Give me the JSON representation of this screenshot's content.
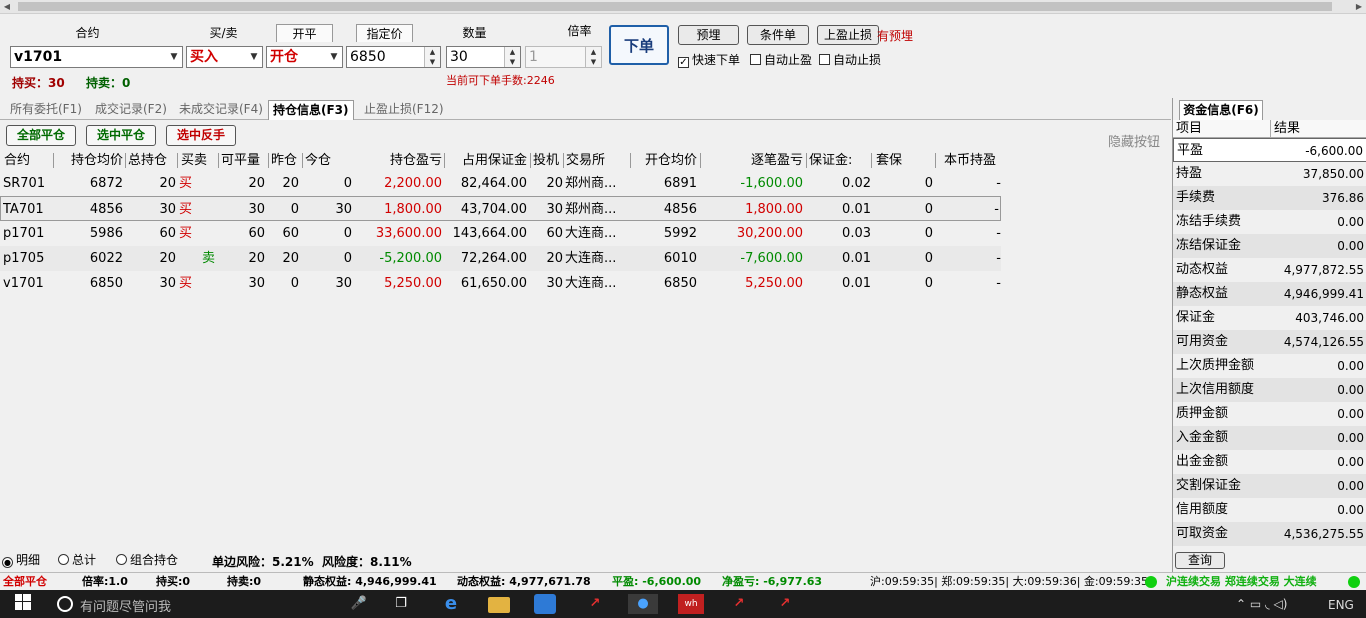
{
  "order_panel": {
    "labels": {
      "contract": "合约",
      "buy_sell": "买/卖",
      "open_close": "开平",
      "price_type": "指定价",
      "quantity": "数量",
      "multiplier": "倍率"
    },
    "contract_value": "v1701",
    "buy_sell_value": "买入",
    "open_close_value": "开仓",
    "price_value": "6850",
    "quantity_value": "30",
    "multiplier_value": "1",
    "hold_buy": "持买：30",
    "hold_sell": "持卖：0",
    "available_hint": "当前可下单手数:2246",
    "submit_label": "下单",
    "preorder_label": "预埋",
    "conditional_label": "条件单",
    "stop_label": "上盈止损",
    "has_preorder": "有预埋",
    "quick_order_label": "快速下单",
    "auto_take_profit_label": "自动止盈",
    "auto_stop_loss_label": "自动止损"
  },
  "tabs": [
    "所有委托(F1)",
    "成交记录(F2)",
    "未成交记录(F4)",
    "持仓信息(F3)",
    "止盈止损(F12)"
  ],
  "position_buttons": {
    "close_all": "全部平仓",
    "close_selected": "选中平仓",
    "reverse_selected": "选中反手"
  },
  "hide_buttons_label": "隐藏按钮",
  "table": {
    "headers": [
      "合约",
      "持仓均价",
      "总持仓",
      "买卖",
      "可平量",
      "昨仓",
      "今仓",
      "持仓盈亏",
      "占用保证金",
      "投机",
      "交易所",
      "开仓均价",
      "逐笔盈亏",
      "保证金:",
      "套保",
      "本币持盈"
    ],
    "rows": [
      {
        "contract": "SR701",
        "avg": "6872",
        "total": "20",
        "bs": "买",
        "closable": "20",
        "yest": "20",
        "today": "0",
        "pnl": "2,200.00",
        "margin": "82,464.00",
        "spec": "20",
        "exch": "郑州商...",
        "open_avg": "6891",
        "trade_pnl": "-1,600.00",
        "mrate": "0.02",
        "hedge": "0",
        "local": "-"
      },
      {
        "contract": "TA701",
        "avg": "4856",
        "total": "30",
        "bs": "买",
        "closable": "30",
        "yest": "0",
        "today": "30",
        "pnl": "1,800.00",
        "margin": "43,704.00",
        "spec": "30",
        "exch": "郑州商...",
        "open_avg": "4856",
        "trade_pnl": "1,800.00",
        "mrate": "0.01",
        "hedge": "0",
        "local": "-"
      },
      {
        "contract": "p1701",
        "avg": "5986",
        "total": "60",
        "bs": "买",
        "closable": "60",
        "yest": "60",
        "today": "0",
        "pnl": "33,600.00",
        "margin": "143,664.00",
        "spec": "60",
        "exch": "大连商...",
        "open_avg": "5992",
        "trade_pnl": "30,200.00",
        "mrate": "0.03",
        "hedge": "0",
        "local": "-"
      },
      {
        "contract": "p1705",
        "avg": "6022",
        "total": "20",
        "bs": "卖",
        "closable": "20",
        "yest": "20",
        "today": "0",
        "pnl": "-5,200.00",
        "margin": "72,264.00",
        "spec": "20",
        "exch": "大连商...",
        "open_avg": "6010",
        "trade_pnl": "-7,600.00",
        "mrate": "0.01",
        "hedge": "0",
        "local": "-"
      },
      {
        "contract": "v1701",
        "avg": "6850",
        "total": "30",
        "bs": "买",
        "closable": "30",
        "yest": "0",
        "today": "30",
        "pnl": "5,250.00",
        "margin": "61,650.00",
        "spec": "30",
        "exch": "大连商...",
        "open_avg": "6850",
        "trade_pnl": "5,250.00",
        "mrate": "0.01",
        "hedge": "0",
        "local": "-"
      }
    ]
  },
  "bottom_options": {
    "detail": "明细",
    "total": "总计",
    "combo": "组合持仓",
    "single_risk": "单边风险：5.21%",
    "risk_degree": "风险度：8.11%"
  },
  "fund_panel": {
    "title": "资金信息(F6)",
    "col_item": "项目",
    "col_result": "结果",
    "rows": [
      {
        "k": "平盈",
        "v": "-6,600.00"
      },
      {
        "k": "持盈",
        "v": "37,850.00"
      },
      {
        "k": "手续费",
        "v": "376.86"
      },
      {
        "k": "冻结手续费",
        "v": "0.00"
      },
      {
        "k": "冻结保证金",
        "v": "0.00"
      },
      {
        "k": "动态权益",
        "v": "4,977,872.55"
      },
      {
        "k": "静态权益",
        "v": "4,946,999.41"
      },
      {
        "k": "保证金",
        "v": "403,746.00"
      },
      {
        "k": "可用资金",
        "v": "4,574,126.55"
      },
      {
        "k": "上次质押金额",
        "v": "0.00"
      },
      {
        "k": "上次信用额度",
        "v": "0.00"
      },
      {
        "k": "质押金额",
        "v": "0.00"
      },
      {
        "k": "入金金额",
        "v": "0.00"
      },
      {
        "k": "出金金额",
        "v": "0.00"
      },
      {
        "k": "交割保证金",
        "v": "0.00"
      },
      {
        "k": "信用额度",
        "v": "0.00"
      },
      {
        "k": "可取资金",
        "v": "4,536,275.55"
      }
    ],
    "query_label": "查询"
  },
  "status_bar": {
    "close_all": "全部平仓",
    "rate": "倍率:1.0",
    "hold_buy": "持买:0",
    "hold_sell": "持卖:0",
    "static_equity": "静态权益: 4,946,999.41",
    "dynamic_equity": "动态权益: 4,977,671.78",
    "flat_pnl": "平盈: -6,600.00",
    "net_pnl": "净盈亏: -6,977.63",
    "times": "沪:09:59:35| 郑:09:59:35| 大:09:59:36| 金:09:59:35",
    "conn": "沪连续交易 郑连续交易 大连续"
  },
  "taskbar": {
    "search": "有问题尽管问我",
    "lang": "ENG"
  },
  "colors": {
    "loss": "#008a00",
    "profit": "#d10000",
    "submit_border": "#1f5fa8"
  }
}
